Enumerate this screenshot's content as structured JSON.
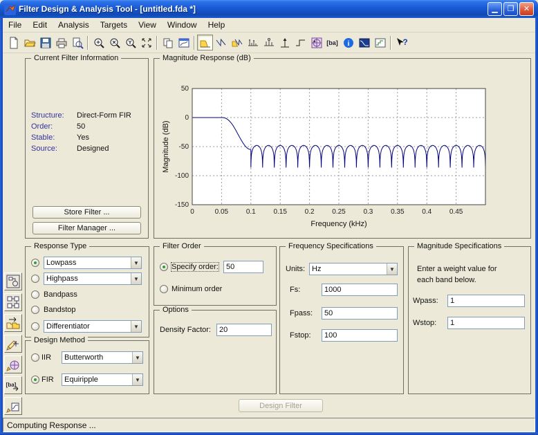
{
  "window": {
    "title": "Filter Design & Analysis Tool -  [untitled.fda *]",
    "controls": {
      "minimize": "🗕",
      "maximize": "🗖",
      "close": "✕"
    }
  },
  "menu": {
    "items": [
      {
        "label": "File"
      },
      {
        "label": "Edit"
      },
      {
        "label": "Analysis"
      },
      {
        "label": "Targets"
      },
      {
        "label": "View"
      },
      {
        "label": "Window"
      },
      {
        "label": "Help"
      }
    ]
  },
  "toolbar": {
    "coefficients_label": "[ba]",
    "help_mark": "?",
    "icons": [
      "new-file",
      "open-file",
      "save",
      "print",
      "print-preview",
      "zoom-in",
      "zoom-x",
      "zoom-y",
      "full-view",
      "copy",
      "print-to-figure",
      "magnitude-response (selected)",
      "phase-response",
      "magnitude-and-phase",
      "group-delay",
      "phase-delay",
      "impulse-response",
      "step-response",
      "pole-zero-plot",
      "filter-coefficients",
      "filter-info",
      "specification-mask",
      "quantized-response",
      "help-mode"
    ]
  },
  "sidebar": {
    "buttons": [
      "realize-model",
      "transform-filter",
      "multirate-filter",
      "pole-zero-editor",
      "set-quantization",
      "import-filter",
      "design-filter"
    ]
  },
  "current_filter_info": {
    "title": "Current Filter Information",
    "fields": [
      {
        "label": "Structure:",
        "value": "Direct-Form FIR"
      },
      {
        "label": "Order:",
        "value": "50"
      },
      {
        "label": "Stable:",
        "value": "Yes"
      },
      {
        "label": "Source:",
        "value": "Designed"
      }
    ],
    "store_button": "Store Filter ...",
    "manager_button": "Filter Manager ..."
  },
  "chart_data": {
    "type": "line",
    "title": "Magnitude Response (dB)",
    "xlabel": "Frequency (kHz)",
    "ylabel": "Magnitude (dB)",
    "xlim": [
      0,
      0.5
    ],
    "ylim": [
      -150,
      50
    ],
    "xticks": [
      0,
      0.05,
      0.1,
      0.15,
      0.2,
      0.25,
      0.3,
      0.35,
      0.4,
      0.45
    ],
    "yticks": [
      50,
      0,
      -50,
      -100,
      -150
    ],
    "grid": true,
    "line_color": "#00007f",
    "series": [
      {
        "name": "Lowpass FIR equiripple magnitude response",
        "model": {
          "passband_level_db": 0,
          "passband_edge_khz": 0.05,
          "stopband_edge_khz": 0.1,
          "transition_end_db": -55,
          "stopband_peak_db": -48,
          "num_stopband_lobes": 20,
          "null_depths_db": [
            -88,
            -97,
            -108,
            -97,
            -110,
            -100,
            -125,
            -96,
            -118,
            -100,
            -125,
            -105,
            -122,
            -98,
            -112,
            -100,
            -125,
            -104,
            -110,
            -98
          ]
        }
      }
    ]
  },
  "response_type": {
    "title": "Response Type",
    "options": [
      {
        "label": "Lowpass",
        "selected": true
      },
      {
        "label": "Highpass",
        "selected": false
      },
      {
        "label": "Bandpass",
        "selected": false
      },
      {
        "label": "Bandstop",
        "selected": false
      },
      {
        "label": "Differentiator",
        "selected": false
      }
    ]
  },
  "design_method": {
    "title": "Design Method",
    "iir_label": "IIR",
    "iir_value": "Butterworth",
    "iir_selected": false,
    "fir_label": "FIR",
    "fir_value": "Equiripple",
    "fir_selected": true
  },
  "filter_order": {
    "title": "Filter Order",
    "specify_label": "Specify order:",
    "specify_value": "50",
    "specify_selected": true,
    "minimum_label": "Minimum order",
    "minimum_selected": false
  },
  "options_panel": {
    "title": "Options",
    "density_label": "Density Factor:",
    "density_value": "20"
  },
  "frequency_specs": {
    "title": "Frequency Specifications",
    "units_label": "Units:",
    "units_value": "Hz",
    "fields": [
      {
        "label": "Fs:",
        "value": "1000"
      },
      {
        "label": "Fpass:",
        "value": "50"
      },
      {
        "label": "Fstop:",
        "value": "100"
      }
    ]
  },
  "magnitude_specs": {
    "title": "Magnitude Specifications",
    "note_line1": "Enter a weight value for",
    "note_line2": "each band below.",
    "fields": [
      {
        "label": "Wpass:",
        "value": "1"
      },
      {
        "label": "Wstop:",
        "value": "1"
      }
    ]
  },
  "design_button": {
    "label": "Design Filter",
    "enabled": false
  },
  "status_bar": {
    "text": "Computing Response ..."
  },
  "colors": {
    "titlebar_blue": "#1b5cd9",
    "client_beige": "#ece9d8",
    "curve_navy": "#00007f",
    "label_navy": "#33339c",
    "radio_green": "#2f9e2f",
    "close_red": "#df5b3d"
  }
}
